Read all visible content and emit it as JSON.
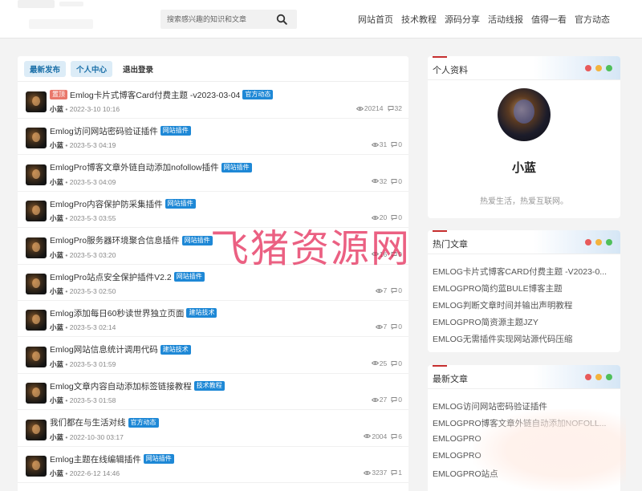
{
  "header": {
    "search_placeholder": "搜索感兴趣的知识和文章",
    "nav": [
      "网站首页",
      "技术教程",
      "源码分享",
      "活动线报",
      "值得一看",
      "官方动态"
    ]
  },
  "tabs": [
    "最新发布",
    "个人中心",
    "退出登录"
  ],
  "posts": [
    {
      "sticky": "置顶",
      "title": "Emlog卡片式博客Card付费主题 -v2023-03-04",
      "category": "官方动态",
      "author": "小蓝",
      "date": "2022-3-10 10:16",
      "views": "20214",
      "comments": "32"
    },
    {
      "sticky": "",
      "title": "Emlog访问网站密码验证插件",
      "category": "网站插件",
      "author": "小蓝",
      "date": "2023-5-3 04:19",
      "views": "31",
      "comments": "0"
    },
    {
      "sticky": "",
      "title": "EmlogPro博客文章外链自动添加nofollow插件",
      "category": "网站插件",
      "author": "小蓝",
      "date": "2023-5-3 04:09",
      "views": "32",
      "comments": "0"
    },
    {
      "sticky": "",
      "title": "EmlogPro内容保护防采集插件",
      "category": "网站插件",
      "author": "小蓝",
      "date": "2023-5-3 03:55",
      "views": "20",
      "comments": "0"
    },
    {
      "sticky": "",
      "title": "EmlogPro服务器环境聚合信息插件",
      "category": "网站插件",
      "author": "小蓝",
      "date": "2023-5-3 03:20",
      "views": "16",
      "comments": "0"
    },
    {
      "sticky": "",
      "title": "EmlogPro站点安全保护插件V2.2",
      "category": "网站插件",
      "author": "小蓝",
      "date": "2023-5-3 02:50",
      "views": "7",
      "comments": "0"
    },
    {
      "sticky": "",
      "title": "Emlog添加每日60秒读世界独立页面",
      "category": "建站技术",
      "author": "小蓝",
      "date": "2023-5-3 02:14",
      "views": "7",
      "comments": "0"
    },
    {
      "sticky": "",
      "title": "Emlog网站信息统计调用代码",
      "category": "建站技术",
      "author": "小蓝",
      "date": "2023-5-3 01:59",
      "views": "25",
      "comments": "0"
    },
    {
      "sticky": "",
      "title": "Emlog文章内容自动添加标签链接教程",
      "category": "技术教程",
      "author": "小蓝",
      "date": "2023-5-3 01:58",
      "views": "27",
      "comments": "0"
    },
    {
      "sticky": "",
      "title": "我们都在与生活对线",
      "category": "官方动态",
      "author": "小蓝",
      "date": "2022-10-30 03:17",
      "views": "2004",
      "comments": "6"
    },
    {
      "sticky": "",
      "title": "Emlog主题在线编辑插件",
      "category": "网站插件",
      "author": "小蓝",
      "date": "2022-6-12 14:46",
      "views": "3237",
      "comments": "1"
    }
  ],
  "watermark": "飞猪资源网",
  "profile": {
    "title": "个人资料",
    "name": "小蓝",
    "bio": "热爱生活，热爱互联网。"
  },
  "hot": {
    "title": "热门文章",
    "items": [
      "EMLOG卡片式博客CARD付费主题 -V2023-0...",
      "EMLOGPRO简约蓝BULE博客主题",
      "EMLOG判断文章时间并输出声明教程",
      "EMLOGPRO简资源主题JZY",
      "EMLOG无需插件实现网站源代码压缩"
    ]
  },
  "latest": {
    "title": "最新文章",
    "items": [
      "EMLOG访问网站密码验证插件",
      "EMLOGPRO博客文章外链自动添加NOFOLL...",
      "EMLOGPRO",
      "EMLOGPRO",
      "EMLOGPRO站点"
    ]
  },
  "colors": {
    "accent": "#1e88d6",
    "sticky": "#e9776a",
    "watermark": "#e32252",
    "panel_bar": "#c62f2f"
  }
}
